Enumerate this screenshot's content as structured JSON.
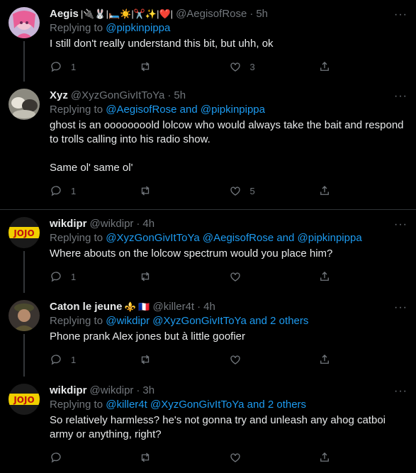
{
  "tweets": [
    {
      "name": "Aegis",
      "name_suffix": "|🔌🐰|🛏️☀️|✂️✨|❤️|",
      "handle": "@AegisofRose",
      "time": "5h",
      "replying_prefix": "Replying to ",
      "mentions": [
        "@pipkinpippa"
      ],
      "text": "I still don't really understand this bit, but uhh, ok",
      "reply_count": "1",
      "retweet_count": "",
      "like_count": "3"
    },
    {
      "name": "Xyz",
      "name_suffix": "",
      "handle": "@XyzGonGivItToYa",
      "time": "5h",
      "replying_prefix": "Replying to ",
      "mentions": [
        "@AegisofRose",
        " and ",
        "@pipkinpippa"
      ],
      "text": "ghost is an oooooooold lolcow who would always take the bait and respond to trolls calling into his radio show.\n\nSame ol' same ol'",
      "reply_count": "1",
      "retweet_count": "",
      "like_count": "5"
    },
    {
      "name": "wikdipr",
      "name_suffix": "",
      "handle": "@wikdipr",
      "time": "4h",
      "replying_prefix": "Replying to ",
      "mentions": [
        "@XyzGonGivItToYa",
        " ",
        "@AegisofRose",
        " and ",
        "@pipkinpippa"
      ],
      "text": "Where abouts on the lolcow spectrum would you place him?",
      "reply_count": "1",
      "retweet_count": "",
      "like_count": ""
    },
    {
      "name": "Caton le jeune",
      "name_suffix": "⚜️ 🇫🇷",
      "handle": "@killer4t",
      "time": "4h",
      "replying_prefix": "Replying to ",
      "mentions": [
        "@wikdipr",
        " ",
        "@XyzGonGivItToYa",
        " and ",
        "2 others"
      ],
      "text": "Phone prank Alex jones but à little goofier",
      "reply_count": "1",
      "retweet_count": "",
      "like_count": ""
    },
    {
      "name": "wikdipr",
      "name_suffix": "",
      "handle": "@wikdipr",
      "time": "3h",
      "replying_prefix": "Replying to ",
      "mentions": [
        "@killer4t",
        " ",
        "@XyzGonGivItToYa",
        " and ",
        "2 others"
      ],
      "text": "So relatively harmless? he's not gonna try and unleash any ahog catboi army or anything, right?",
      "reply_count": "",
      "retweet_count": "",
      "like_count": ""
    }
  ],
  "more_label": "···",
  "dot": "·",
  "colors": {
    "background": "#000000",
    "text": "#e7e9ea",
    "muted": "#71767b",
    "accent": "#1d9bf0",
    "line": "#333639"
  },
  "icons": [
    "reply-icon",
    "retweet-icon",
    "like-icon",
    "share-icon",
    "more-icon"
  ]
}
